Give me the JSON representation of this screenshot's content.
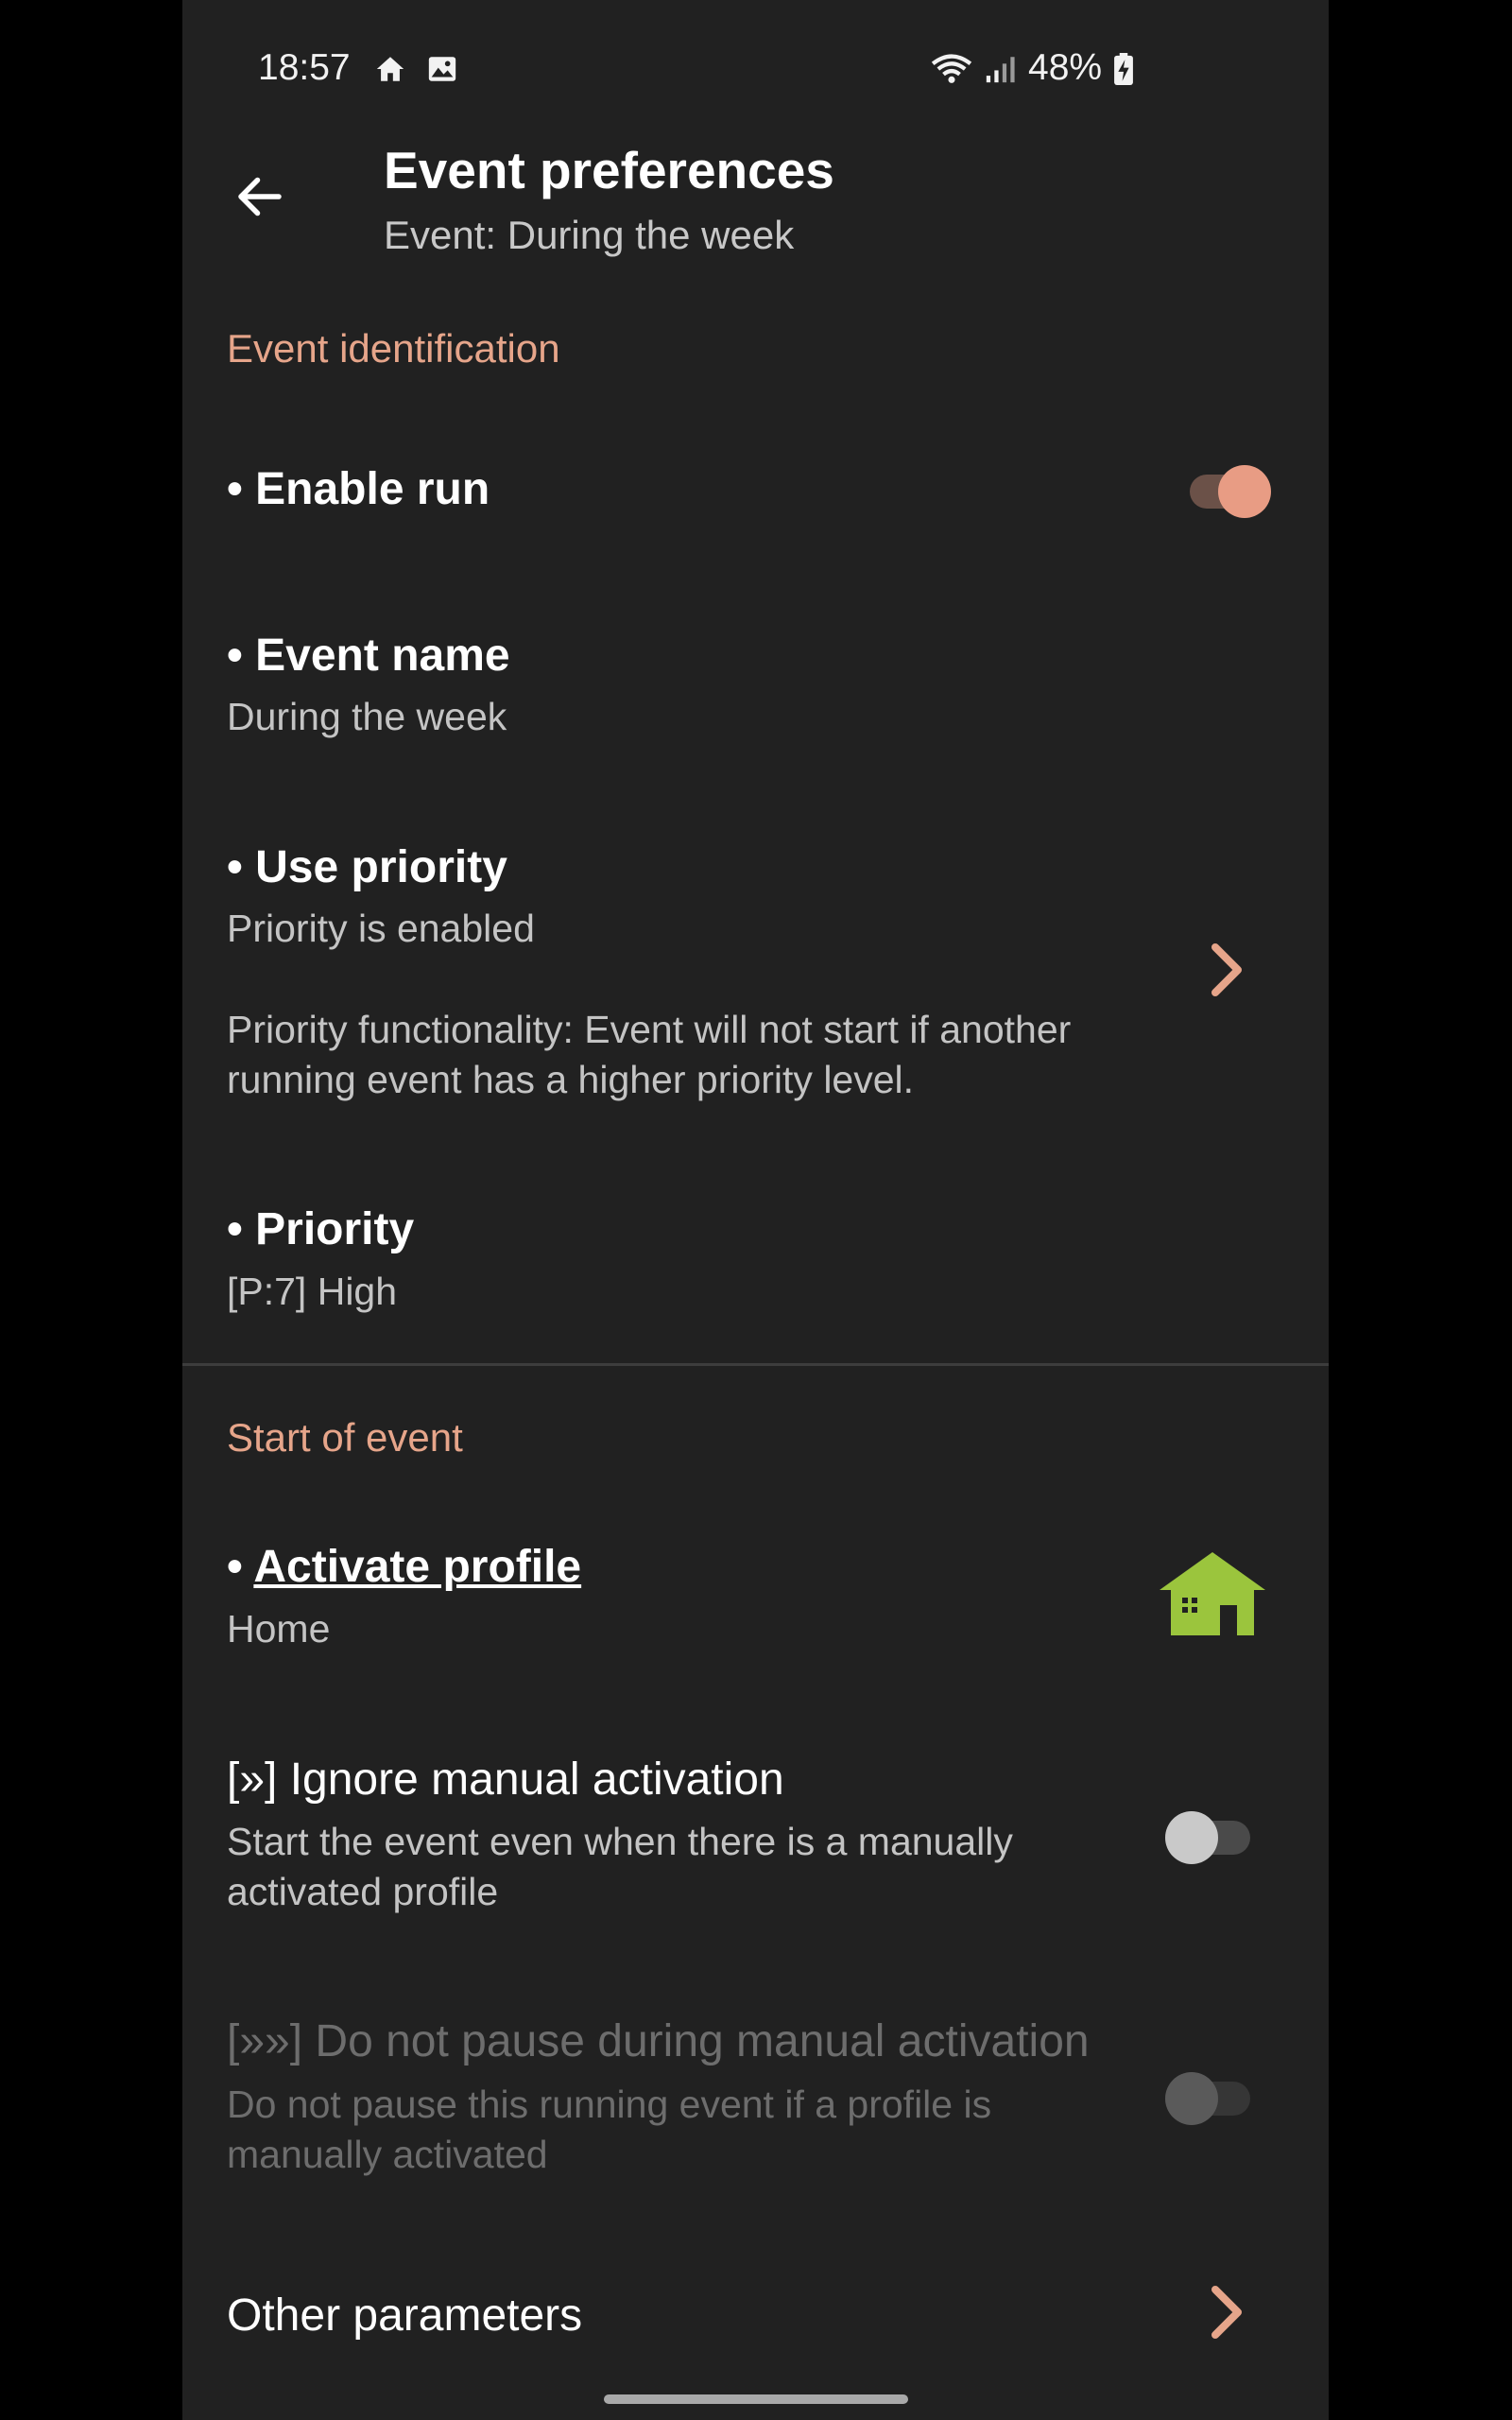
{
  "status_bar": {
    "time": "18:57",
    "battery": "48%",
    "icons": [
      "home-icon",
      "image-icon",
      "wifi-icon",
      "signal-icon",
      "battery-charging-icon"
    ]
  },
  "app_bar": {
    "title": "Event preferences",
    "subtitle": "Event: During the week",
    "back_icon": "arrow-left-icon"
  },
  "sections": {
    "identification": "Event identification",
    "start": "Start of event"
  },
  "prefs": {
    "enable_run": {
      "title": "• Enable run",
      "checked": true
    },
    "event_name": {
      "title": "• Event name",
      "value": "During the week"
    },
    "use_priority": {
      "title": "• Use priority",
      "value": "Priority is enabled",
      "desc_line1": "Priority functionality: Event will not start if another",
      "desc_line2": "running event has a higher priority level."
    },
    "priority": {
      "title": "• Priority",
      "value": "[P:7] High"
    },
    "activate_profile": {
      "bullet": "• ",
      "title": "Activate profile",
      "value": "Home",
      "icon": "house-icon"
    },
    "ignore_manual": {
      "title": "[»] Ignore manual activation",
      "line1": "Start the event even when there is a manually",
      "line2": "activated profile",
      "checked": false
    },
    "do_not_pause": {
      "title": "[»»] Do not pause during manual activation",
      "line1": "Do not pause this running event if a profile is",
      "line2": "manually activated",
      "checked": false,
      "enabled": false
    },
    "other_parameters": {
      "title": "Other parameters"
    }
  },
  "colors": {
    "background": "#212121",
    "accent": "#e6a58a",
    "switch_on": "#e89c84",
    "house": "#9bc53d"
  }
}
